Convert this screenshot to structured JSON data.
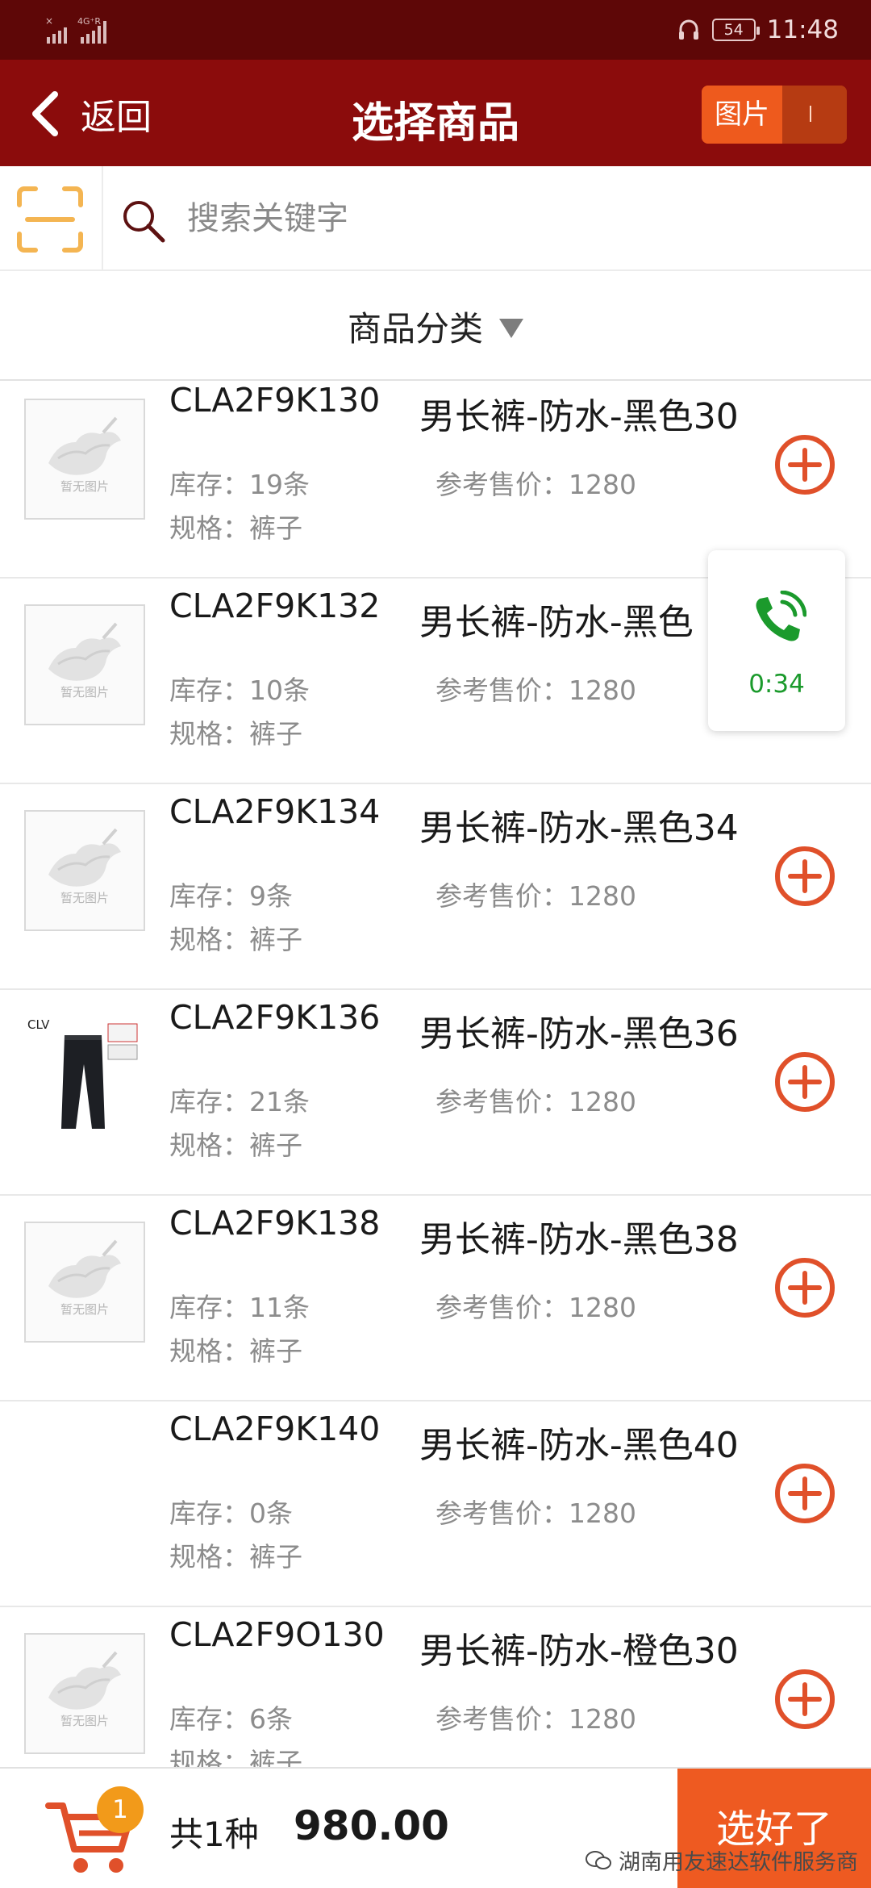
{
  "status": {
    "time": "11:48",
    "battery": "54"
  },
  "header": {
    "back_label": "返回",
    "title": "选择商品",
    "image_toggle_label": "图片"
  },
  "search": {
    "placeholder": "搜索关键字"
  },
  "category": {
    "label": "商品分类"
  },
  "no_image_text": "暂无图片",
  "products": [
    {
      "code": "CLA2F9K130",
      "name": "男长裤-防水-黑色30",
      "stock": "库存：19条",
      "price": "参考售价：1280",
      "spec": "规格：裤子",
      "image": "none"
    },
    {
      "code": "CLA2F9K132",
      "name": "男长裤-防水-黑色",
      "stock": "库存：10条",
      "price": "参考售价：1280",
      "spec": "规格：裤子",
      "image": "none"
    },
    {
      "code": "CLA2F9K134",
      "name": "男长裤-防水-黑色34",
      "stock": "库存：9条",
      "price": "参考售价：1280",
      "spec": "规格：裤子",
      "image": "none"
    },
    {
      "code": "CLA2F9K136",
      "name": "男长裤-防水-黑色36",
      "stock": "库存：21条",
      "price": "参考售价：1280",
      "spec": "规格：裤子",
      "image": "photo"
    },
    {
      "code": "CLA2F9K138",
      "name": "男长裤-防水-黑色38",
      "stock": "库存：11条",
      "price": "参考售价：1280",
      "spec": "规格：裤子",
      "image": "none"
    },
    {
      "code": "CLA2F9K140",
      "name": "男长裤-防水-黑色40",
      "stock": "库存：0条",
      "price": "参考售价：1280",
      "spec": "规格：裤子",
      "image": "blank"
    },
    {
      "code": "CLA2F9O130",
      "name": "男长裤-防水-橙色30",
      "stock": "库存：6条",
      "price": "参考售价：1280",
      "spec": "规格：裤子",
      "image": "none"
    }
  ],
  "photo_brand": "CLV",
  "call": {
    "duration": "0:34"
  },
  "footer": {
    "cart_badge": "1",
    "count_label": "共1种",
    "total": "980.00",
    "done_label": "选好了"
  },
  "watermark": "湖南用友速达软件服务商",
  "colors": {
    "status_bar": "#5e0707",
    "header": "#8b0c0c",
    "accent": "#ee5a21",
    "add_icon": "#e0502a",
    "call_green": "#1b9a2c",
    "badge": "#f29a1a"
  }
}
